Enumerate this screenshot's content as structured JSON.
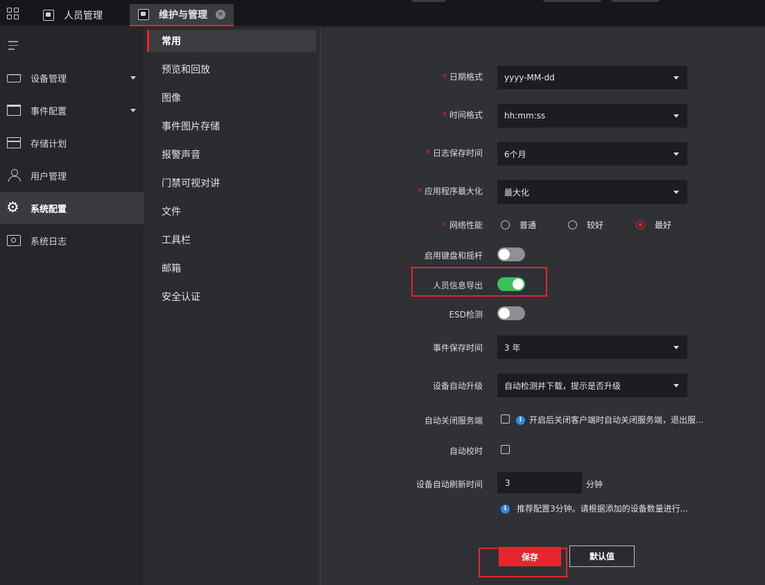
{
  "colors": {
    "accent": "#e8242c",
    "toggle_on": "#3cc15a",
    "info": "#2e8ae6"
  },
  "topbar": {
    "tabs": [
      {
        "label": "人员管理",
        "icon": "person-card-icon"
      },
      {
        "label": "维护与管理",
        "icon": "maintenance-icon",
        "active": true
      }
    ]
  },
  "sidebar": {
    "items": [
      {
        "label": "设备管理",
        "icon": "device-icon",
        "expandable": true
      },
      {
        "label": "事件配置",
        "icon": "event-icon",
        "expandable": true
      },
      {
        "label": "存储计划",
        "icon": "storage-icon"
      },
      {
        "label": "用户管理",
        "icon": "user-icon"
      },
      {
        "label": "系统配置",
        "icon": "gear-icon",
        "active": true
      },
      {
        "label": "系统日志",
        "icon": "log-icon"
      }
    ]
  },
  "subnav": {
    "items": [
      "常用",
      "预览和回放",
      "图像",
      "事件图片存储",
      "报警声音",
      "门禁可视对讲",
      "文件",
      "工具栏",
      "邮箱",
      "安全认证"
    ],
    "active_index": 0
  },
  "form": {
    "date_format": {
      "label": "日期格式",
      "required": true,
      "value": "yyyy-MM-dd"
    },
    "time_format": {
      "label": "时间格式",
      "required": true,
      "value": "hh:mm:ss"
    },
    "log_retention": {
      "label": "日志保存时间",
      "required": true,
      "value": "6个月"
    },
    "app_maximize": {
      "label": "应用程序最大化",
      "required": true,
      "value": "最大化"
    },
    "network": {
      "label": "网络性能",
      "required": true,
      "options": [
        "普通",
        "较好",
        "最好"
      ],
      "selected_index": 2
    },
    "keyboard_joystick": {
      "label": "启用键盘和摇杆",
      "on": false
    },
    "person_export": {
      "label": "人员信息导出",
      "on": true
    },
    "esd": {
      "label": "ESD检测",
      "on": false
    },
    "event_retention": {
      "label": "事件保存时间",
      "value": "3 年"
    },
    "auto_upgrade": {
      "label": "设备自动升级",
      "value": "自动检测并下载，提示是否升级"
    },
    "auto_close_service": {
      "label": "自动关闭服务端",
      "checked": false,
      "hint": "开启后关闭客户端时自动关闭服务端，退出服..."
    },
    "auto_time_sync": {
      "label": "自动校时",
      "checked": false
    },
    "auto_refresh": {
      "label": "设备自动刷新时间",
      "value": "3",
      "unit": "分钟",
      "hint": "推荐配置3分钟。请根据添加的设备数量进行..."
    }
  },
  "buttons": {
    "save": "保存",
    "default": "默认值"
  }
}
